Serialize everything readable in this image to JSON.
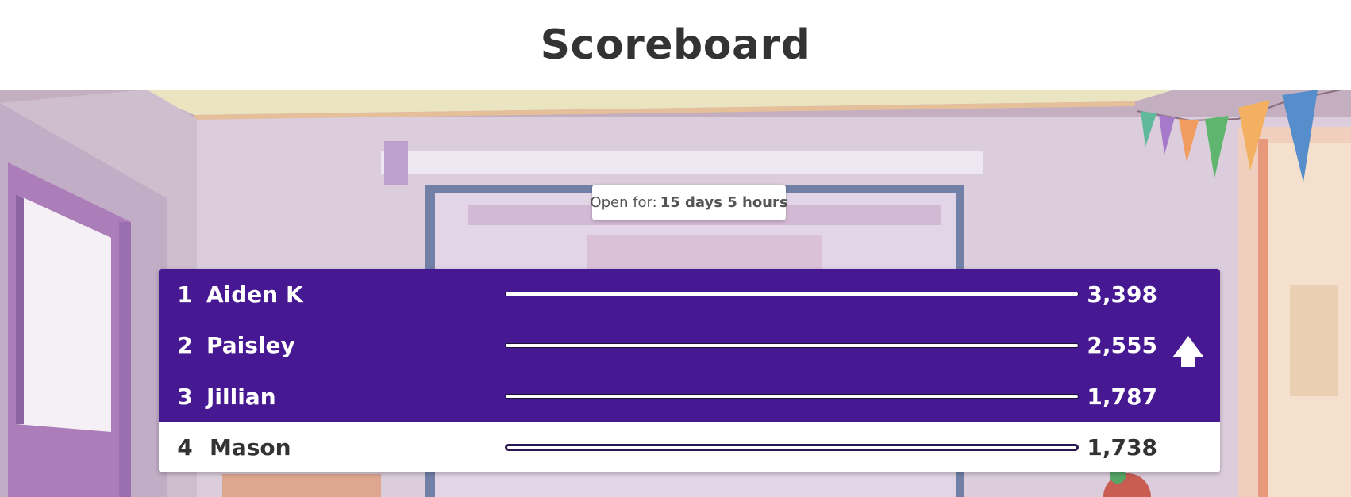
{
  "header": {
    "title": "Scoreboard"
  },
  "status": {
    "open_label": "Open for:",
    "open_value": "15 days 5 hours"
  },
  "scoreboard": [
    {
      "rank": "1",
      "name": "Aiden K",
      "score": "3,398",
      "progress": 1.0,
      "highlighted": false,
      "trend": ""
    },
    {
      "rank": "2",
      "name": "Paisley",
      "score": "2,555",
      "progress": 1.0,
      "highlighted": false,
      "trend": "up"
    },
    {
      "rank": "3",
      "name": "Jillian",
      "score": "1,787",
      "progress": 1.0,
      "highlighted": false,
      "trend": ""
    },
    {
      "rank": "4",
      "name": "Mason",
      "score": "1,738",
      "progress": 1.0,
      "highlighted": true,
      "trend": ""
    }
  ],
  "colors": {
    "board": "#461892",
    "highlight": "#ffffff",
    "title": "#333333"
  },
  "icons": {
    "trend_up": "arrow-up-icon"
  }
}
